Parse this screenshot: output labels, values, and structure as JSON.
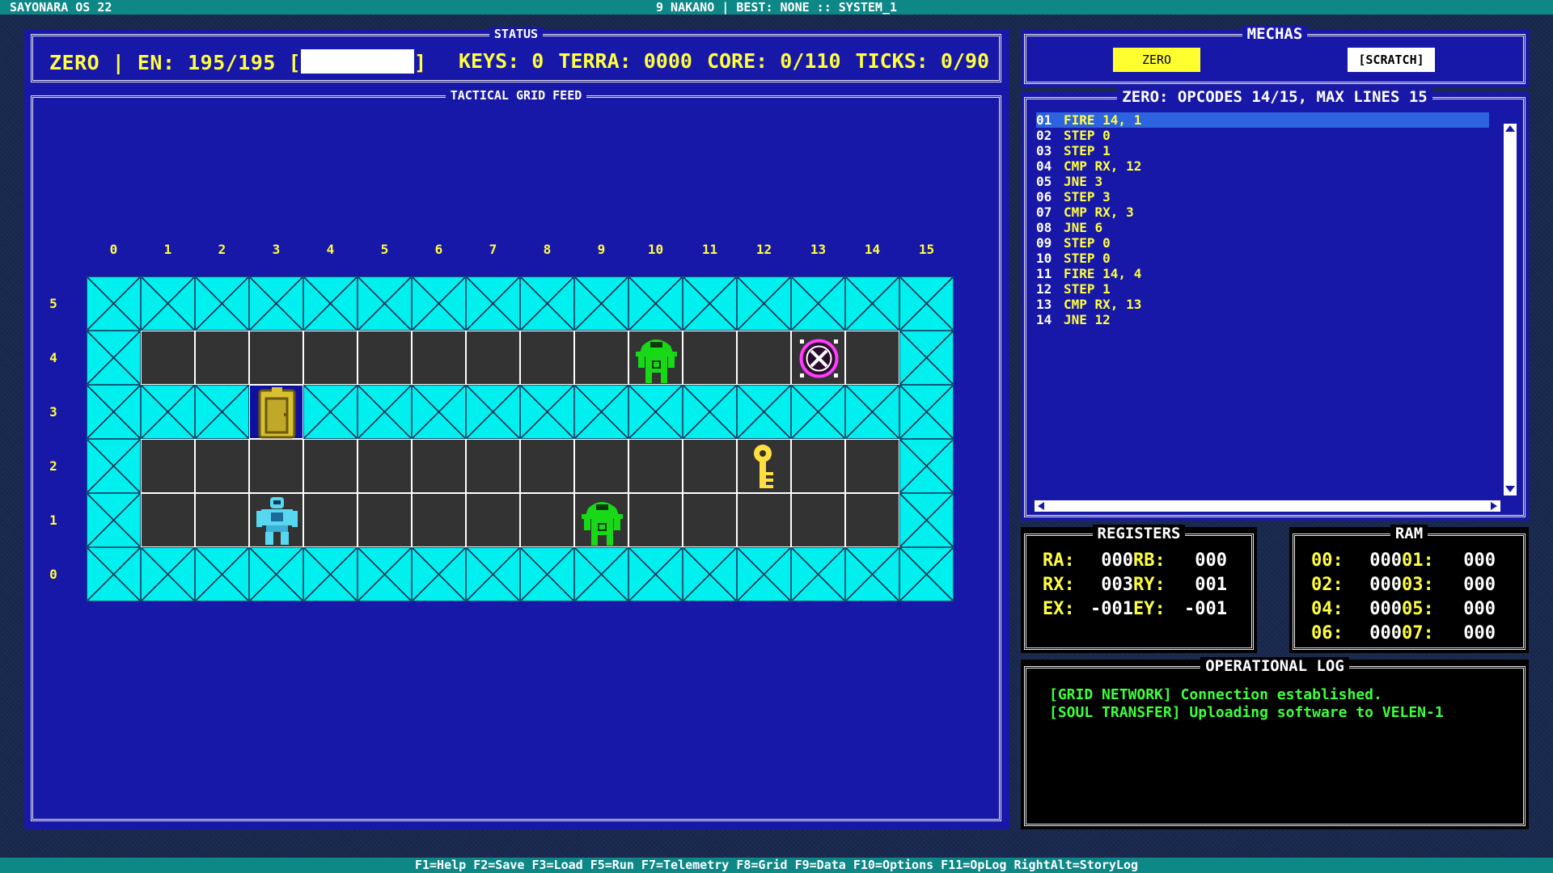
{
  "topbar": {
    "os": "SAYONARA OS 22",
    "info": "9 NAKANO | BEST: NONE :: SYSTEM_1"
  },
  "status": {
    "title": "STATUS",
    "unit": "ZERO",
    "energy_label": "EN:",
    "energy": "195/195",
    "energy_fraction": 1.0,
    "keys": "KEYS: 0",
    "terra": "TERRA: 0000",
    "core": "CORE: 0/110",
    "ticks": "TICKS: 0/90"
  },
  "grid": {
    "title": "TACTICAL GRID FEED",
    "columns": [
      "0",
      "1",
      "2",
      "3",
      "4",
      "5",
      "6",
      "7",
      "8",
      "9",
      "10",
      "11",
      "12",
      "13",
      "14",
      "15"
    ],
    "rows": [
      "5",
      "4",
      "3",
      "2",
      "1",
      "0"
    ],
    "cells": [
      "WWWWWWWWWWWWWWWW",
      "WFFFFFFFFFFFFFFW",
      "WWWDWWWWWWWWWWWW",
      "WFFFFFFFFFFFFFFW",
      "WFFFFFFFFFFFFFFW",
      "WWWWWWWWWWWWWWWW"
    ],
    "entities": [
      {
        "type": "enemy-robot",
        "x": 10,
        "y": 4
      },
      {
        "type": "exit-target",
        "x": 13,
        "y": 4
      },
      {
        "type": "door",
        "x": 3,
        "y": 3
      },
      {
        "type": "key",
        "x": 12,
        "y": 2
      },
      {
        "type": "player-mecha",
        "x": 3,
        "y": 1
      },
      {
        "type": "enemy-robot",
        "x": 9,
        "y": 1
      }
    ]
  },
  "mechas": {
    "title": "MECHAS",
    "items": [
      "ZERO",
      "[SCRATCH]"
    ],
    "selected": 0
  },
  "code": {
    "title": "ZERO: OPCODES 14/15, MAX LINES 15",
    "active_line": 0,
    "lines": [
      {
        "num": "01",
        "text": "FIRE 14, 1"
      },
      {
        "num": "02",
        "text": "STEP 0"
      },
      {
        "num": "03",
        "text": "STEP 1"
      },
      {
        "num": "04",
        "text": "CMP RX, 12"
      },
      {
        "num": "05",
        "text": "JNE 3"
      },
      {
        "num": "06",
        "text": "STEP 3"
      },
      {
        "num": "07",
        "text": "CMP RX, 3"
      },
      {
        "num": "08",
        "text": "JNE 6"
      },
      {
        "num": "09",
        "text": "STEP 0"
      },
      {
        "num": "10",
        "text": "STEP 0"
      },
      {
        "num": "11",
        "text": "FIRE 14, 4"
      },
      {
        "num": "12",
        "text": "STEP 1"
      },
      {
        "num": "13",
        "text": "CMP RX, 13"
      },
      {
        "num": "14",
        "text": "JNE 12"
      }
    ]
  },
  "registers": {
    "title": "REGISTERS",
    "rows": [
      {
        "l1": "RA:",
        "v1": "000",
        "l2": "RB:",
        "v2": "000"
      },
      {
        "l1": "RX:",
        "v1": "003",
        "l2": "RY:",
        "v2": "001"
      },
      {
        "l1": "EX:",
        "v1": "-001",
        "l2": "EY:",
        "v2": "-001"
      }
    ]
  },
  "ram": {
    "title": "RAM",
    "rows": [
      {
        "l1": "00:",
        "v1": "000",
        "l2": "01:",
        "v2": "000"
      },
      {
        "l1": "02:",
        "v1": "000",
        "l2": "03:",
        "v2": "000"
      },
      {
        "l1": "04:",
        "v1": "000",
        "l2": "05:",
        "v2": "000"
      },
      {
        "l1": "06:",
        "v1": "000",
        "l2": "07:",
        "v2": "000"
      }
    ]
  },
  "log": {
    "title": "OPERATIONAL LOG",
    "lines": [
      "[GRID NETWORK] Connection established.",
      "[SOUL TRANSFER] Uploading software to VELEN-1"
    ]
  },
  "footer": "F1=Help F2=Save F3=Load F5=Run F7=Telemetry F8=Grid F9=Data F10=Options F11=OpLog RightAlt=StoryLog",
  "colors": {
    "accent": "#ffff40",
    "wall": "#00f0f0",
    "floor": "#333333",
    "panel": "#1818a8",
    "log_text": "#3dff3d"
  }
}
